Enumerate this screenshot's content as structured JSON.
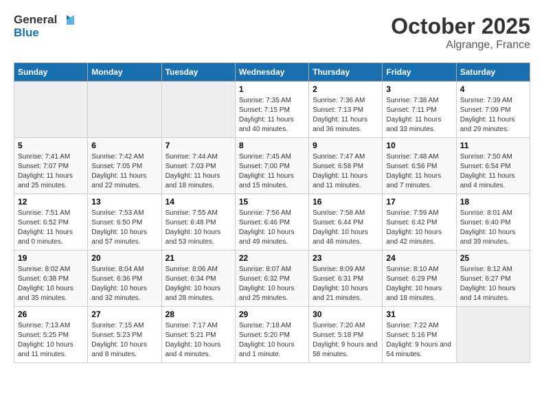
{
  "header": {
    "logo_general": "General",
    "logo_blue": "Blue",
    "month": "October 2025",
    "location": "Algrange, France"
  },
  "weekdays": [
    "Sunday",
    "Monday",
    "Tuesday",
    "Wednesday",
    "Thursday",
    "Friday",
    "Saturday"
  ],
  "weeks": [
    [
      {
        "day": "",
        "info": ""
      },
      {
        "day": "",
        "info": ""
      },
      {
        "day": "",
        "info": ""
      },
      {
        "day": "1",
        "info": "Sunrise: 7:35 AM\nSunset: 7:15 PM\nDaylight: 11 hours and 40 minutes."
      },
      {
        "day": "2",
        "info": "Sunrise: 7:36 AM\nSunset: 7:13 PM\nDaylight: 11 hours and 36 minutes."
      },
      {
        "day": "3",
        "info": "Sunrise: 7:38 AM\nSunset: 7:11 PM\nDaylight: 11 hours and 33 minutes."
      },
      {
        "day": "4",
        "info": "Sunrise: 7:39 AM\nSunset: 7:09 PM\nDaylight: 11 hours and 29 minutes."
      }
    ],
    [
      {
        "day": "5",
        "info": "Sunrise: 7:41 AM\nSunset: 7:07 PM\nDaylight: 11 hours and 25 minutes."
      },
      {
        "day": "6",
        "info": "Sunrise: 7:42 AM\nSunset: 7:05 PM\nDaylight: 11 hours and 22 minutes."
      },
      {
        "day": "7",
        "info": "Sunrise: 7:44 AM\nSunset: 7:03 PM\nDaylight: 11 hours and 18 minutes."
      },
      {
        "day": "8",
        "info": "Sunrise: 7:45 AM\nSunset: 7:00 PM\nDaylight: 11 hours and 15 minutes."
      },
      {
        "day": "9",
        "info": "Sunrise: 7:47 AM\nSunset: 6:58 PM\nDaylight: 11 hours and 11 minutes."
      },
      {
        "day": "10",
        "info": "Sunrise: 7:48 AM\nSunset: 6:56 PM\nDaylight: 11 hours and 7 minutes."
      },
      {
        "day": "11",
        "info": "Sunrise: 7:50 AM\nSunset: 6:54 PM\nDaylight: 11 hours and 4 minutes."
      }
    ],
    [
      {
        "day": "12",
        "info": "Sunrise: 7:51 AM\nSunset: 6:52 PM\nDaylight: 11 hours and 0 minutes."
      },
      {
        "day": "13",
        "info": "Sunrise: 7:53 AM\nSunset: 6:50 PM\nDaylight: 10 hours and 57 minutes."
      },
      {
        "day": "14",
        "info": "Sunrise: 7:55 AM\nSunset: 6:48 PM\nDaylight: 10 hours and 53 minutes."
      },
      {
        "day": "15",
        "info": "Sunrise: 7:56 AM\nSunset: 6:46 PM\nDaylight: 10 hours and 49 minutes."
      },
      {
        "day": "16",
        "info": "Sunrise: 7:58 AM\nSunset: 6:44 PM\nDaylight: 10 hours and 46 minutes."
      },
      {
        "day": "17",
        "info": "Sunrise: 7:59 AM\nSunset: 6:42 PM\nDaylight: 10 hours and 42 minutes."
      },
      {
        "day": "18",
        "info": "Sunrise: 8:01 AM\nSunset: 6:40 PM\nDaylight: 10 hours and 39 minutes."
      }
    ],
    [
      {
        "day": "19",
        "info": "Sunrise: 8:02 AM\nSunset: 6:38 PM\nDaylight: 10 hours and 35 minutes."
      },
      {
        "day": "20",
        "info": "Sunrise: 8:04 AM\nSunset: 6:36 PM\nDaylight: 10 hours and 32 minutes."
      },
      {
        "day": "21",
        "info": "Sunrise: 8:06 AM\nSunset: 6:34 PM\nDaylight: 10 hours and 28 minutes."
      },
      {
        "day": "22",
        "info": "Sunrise: 8:07 AM\nSunset: 6:32 PM\nDaylight: 10 hours and 25 minutes."
      },
      {
        "day": "23",
        "info": "Sunrise: 8:09 AM\nSunset: 6:31 PM\nDaylight: 10 hours and 21 minutes."
      },
      {
        "day": "24",
        "info": "Sunrise: 8:10 AM\nSunset: 6:29 PM\nDaylight: 10 hours and 18 minutes."
      },
      {
        "day": "25",
        "info": "Sunrise: 8:12 AM\nSunset: 6:27 PM\nDaylight: 10 hours and 14 minutes."
      }
    ],
    [
      {
        "day": "26",
        "info": "Sunrise: 7:13 AM\nSunset: 5:25 PM\nDaylight: 10 hours and 11 minutes."
      },
      {
        "day": "27",
        "info": "Sunrise: 7:15 AM\nSunset: 5:23 PM\nDaylight: 10 hours and 8 minutes."
      },
      {
        "day": "28",
        "info": "Sunrise: 7:17 AM\nSunset: 5:21 PM\nDaylight: 10 hours and 4 minutes."
      },
      {
        "day": "29",
        "info": "Sunrise: 7:18 AM\nSunset: 5:20 PM\nDaylight: 10 hours and 1 minute."
      },
      {
        "day": "30",
        "info": "Sunrise: 7:20 AM\nSunset: 5:18 PM\nDaylight: 9 hours and 58 minutes."
      },
      {
        "day": "31",
        "info": "Sunrise: 7:22 AM\nSunset: 5:16 PM\nDaylight: 9 hours and 54 minutes."
      },
      {
        "day": "",
        "info": ""
      }
    ]
  ]
}
